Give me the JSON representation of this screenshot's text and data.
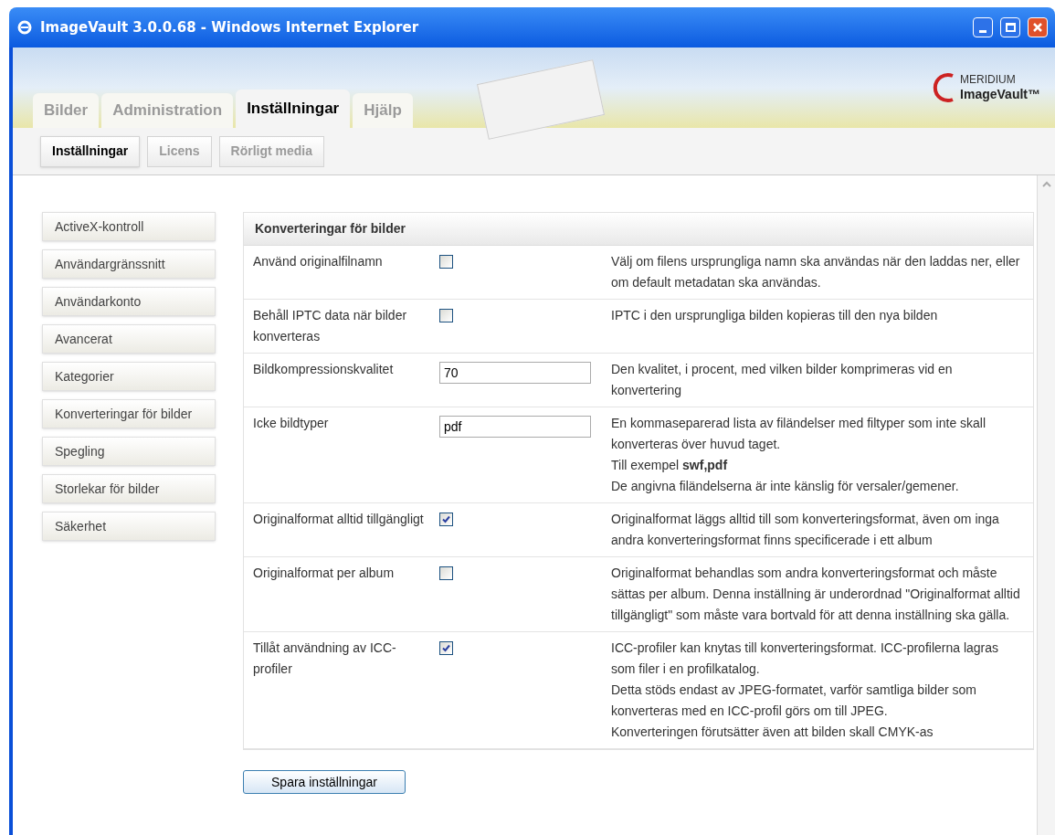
{
  "window": {
    "title": "ImageVault 3.0.0.68 - Windows Internet Explorer"
  },
  "logo": {
    "top": "MERIDIUM",
    "bottom": "ImageVault™"
  },
  "tabs": [
    {
      "label": "Bilder",
      "selected": false
    },
    {
      "label": "Administration",
      "selected": false
    },
    {
      "label": "Inställningar",
      "selected": true
    },
    {
      "label": "Hjälp",
      "selected": false
    }
  ],
  "subtabs": [
    {
      "label": "Inställningar",
      "selected": true
    },
    {
      "label": "Licens",
      "selected": false
    },
    {
      "label": "Rörligt media",
      "selected": false
    }
  ],
  "sidebar": {
    "items": [
      "ActiveX-kontroll",
      "Användargränssnitt",
      "Användarkonto",
      "Avancerat",
      "Kategorier",
      "Konverteringar för bilder",
      "Spegling",
      "Storlekar för bilder",
      "Säkerhet"
    ]
  },
  "panel": {
    "title": "Konverteringar för bilder",
    "rows": [
      {
        "label": "Använd originalfilnamn",
        "kind": "checkbox",
        "checked": false,
        "description": [
          "Välj om filens ursprungliga namn ska användas när den laddas ner, eller om default metadatan ska användas."
        ]
      },
      {
        "label": "Behåll IPTC data när bilder konverteras",
        "kind": "checkbox",
        "checked": false,
        "description": [
          "IPTC i den ursprungliga bilden kopieras till den nya bilden"
        ]
      },
      {
        "label": "Bildkompressionskvalitet",
        "kind": "text",
        "value": "70",
        "description": [
          "Den kvalitet, i procent, med vilken bilder komprimeras vid en konvertering"
        ]
      },
      {
        "label": "Icke bildtyper",
        "kind": "text",
        "value": "pdf",
        "description": [
          "En kommaseparerad lista av filändelser med filtyper som inte skall konverteras över huvud taget.",
          "Till exempel **swf,pdf**",
          "De angivna filändelserna är inte känslig för versaler/gemener."
        ]
      },
      {
        "label": "Originalformat alltid tillgängligt",
        "kind": "checkbox",
        "checked": true,
        "description": [
          "Originalformat läggs alltid till som konverteringsformat, även om inga andra konverteringsformat finns specificerade i ett album"
        ]
      },
      {
        "label": "Originalformat per album",
        "kind": "checkbox",
        "checked": false,
        "description": [
          "Originalformat behandlas som andra konverteringsformat och måste sättas per album. Denna inställning är underordnad \"Originalformat alltid tillgängligt\" som måste vara bortvald för att denna inställning ska gälla."
        ]
      },
      {
        "label": "Tillåt användning av ICC-profiler",
        "kind": "checkbox",
        "checked": true,
        "description": [
          "ICC-profiler kan knytas till konverteringsformat. ICC-profilerna lagras som filer i en profilkatalog.",
          "Detta stöds endast av JPEG-formatet, varför samtliga bilder som konverteras med en ICC-profil görs om till JPEG.",
          "Konverteringen förutsätter även att bilden skall CMYK-as"
        ]
      }
    ]
  },
  "save_button": "Spara inställningar"
}
